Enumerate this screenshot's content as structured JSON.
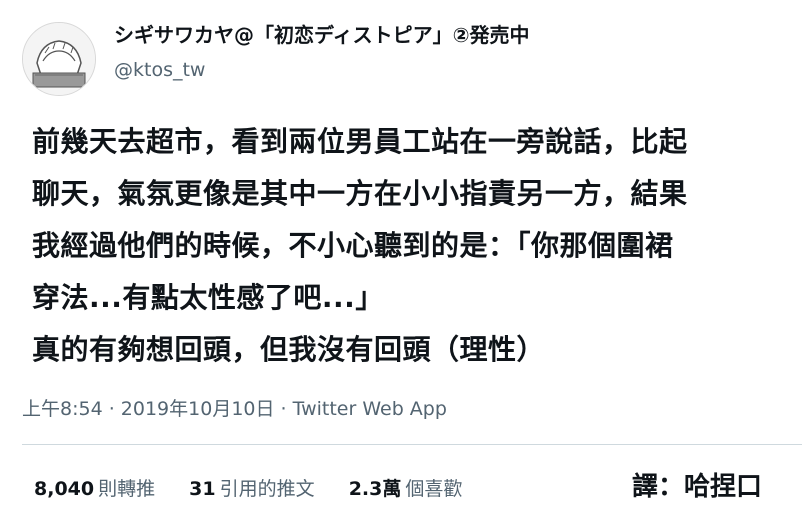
{
  "author": {
    "display_name": "シギサワカヤ@「初恋ディストピア」②発売中",
    "handle": "@ktos_tw"
  },
  "tweet": {
    "lines": [
      "前幾天去超市，看到兩位男員工站在一旁說話，比起",
      "聊天，氣氛更像是其中一方在小小指責另一方，結果",
      "我經過他們的時候，不小心聽到的是：「你那個圍裙",
      "穿法...有點太性感了吧...」",
      "真的有夠想回頭，但我沒有回頭（理性）"
    ]
  },
  "meta": {
    "text": "上午8:54 · 2019年10月10日 · Twitter Web App"
  },
  "stats": {
    "retweets_count": "8,040",
    "retweets_label": "則轉推",
    "quotes_count": "31",
    "quotes_label": "引用的推文",
    "likes_count": "2.3萬",
    "likes_label": "個喜歡"
  },
  "translator": "譯：哈捏口"
}
